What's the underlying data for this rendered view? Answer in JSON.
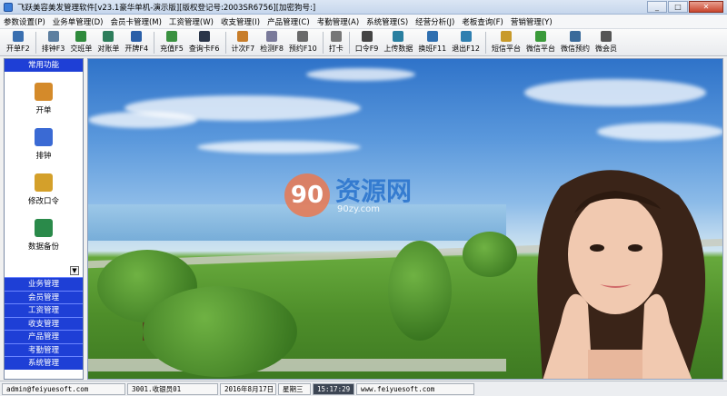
{
  "window": {
    "title": "飞跃美容美发管理软件[v23.1豪华单机-演示版][版权登记号:2003SR6756][加密狗号:]",
    "controls": {
      "minimize": "_",
      "maximize": "□",
      "close": "✕"
    }
  },
  "menu": [
    "参数设置(P)",
    "业务单管理(D)",
    "会员卡管理(M)",
    "工资管理(W)",
    "收支管理(I)",
    "产品管理(C)",
    "考勤管理(A)",
    "系统管理(S)",
    "经营分析(J)",
    "老板查询(F)",
    "营销管理(Y)"
  ],
  "toolbar": [
    {
      "label": "开单F2",
      "icon": "bill-icon",
      "color": "#3a6fb0"
    },
    {
      "label": "排钟F3",
      "icon": "pen-icon",
      "color": "#5d7fa0"
    },
    {
      "label": "交班单",
      "icon": "money-bag-icon",
      "color": "#2f8a3c"
    },
    {
      "label": "对账单",
      "icon": "ledger-icon",
      "color": "#2e7d5b"
    },
    {
      "label": "开牌F4",
      "icon": "grid-icon",
      "color": "#2a5fa8"
    },
    {
      "label": "充值F5",
      "icon": "coin-bag-icon",
      "color": "#3a9140"
    },
    {
      "label": "查询卡F6",
      "icon": "binoculars-icon",
      "color": "#2a3548"
    },
    {
      "label": "计次F7",
      "icon": "counter-icon",
      "color": "#c87d2a"
    },
    {
      "label": "检测F8",
      "icon": "needle-icon",
      "color": "#7a7a9a"
    },
    {
      "label": "预约F10",
      "icon": "document-icon",
      "color": "#6a6a6a"
    },
    {
      "label": "打卡",
      "icon": "clock-icon",
      "color": "#777777"
    },
    {
      "label": "口令F9",
      "icon": "key-icon",
      "color": "#444444"
    },
    {
      "label": "上传数据",
      "icon": "upload-icon",
      "color": "#2a7fa0"
    },
    {
      "label": "换班F11",
      "icon": "swap-icon",
      "color": "#2f6fb0"
    },
    {
      "label": "退出F12",
      "icon": "exit-icon",
      "color": "#2f7fb0"
    },
    {
      "label": "短信平台",
      "icon": "sms-icon",
      "color": "#c89a2a"
    },
    {
      "label": "微信平台",
      "icon": "wechat-icon",
      "color": "#3a9a3a"
    },
    {
      "label": "微信预约",
      "icon": "wechat-booking-icon",
      "color": "#3a6a9a"
    },
    {
      "label": "微会员",
      "icon": "member-icon",
      "color": "#555555"
    }
  ],
  "left_panel": {
    "header": "常用功能",
    "items": [
      {
        "label": "开单",
        "icon": "pencil-paper-icon",
        "color": "#d48a2a"
      },
      {
        "label": "排钟",
        "icon": "schedule-icon",
        "color": "#3a6ad4"
      },
      {
        "label": "修改口令",
        "icon": "users-key-icon",
        "color": "#d4a02a"
      },
      {
        "label": "数据备份",
        "icon": "backup-icon",
        "color": "#2a8a4a"
      }
    ],
    "scroll_arrow": "▼",
    "nav": [
      "业务管理",
      "会员管理",
      "工资管理",
      "收支管理",
      "产品管理",
      "考勤管理",
      "系统管理"
    ]
  },
  "watermark": {
    "logo": "90",
    "text": "资源网",
    "sub": "90zy.com"
  },
  "status": {
    "email": "admin@feiyuesoft.com",
    "operator": "3001.收银员01",
    "date": "2016年8月17日",
    "weekday": "星期三",
    "time": "15:17:29",
    "website": "www.feiyuesoft.com"
  }
}
